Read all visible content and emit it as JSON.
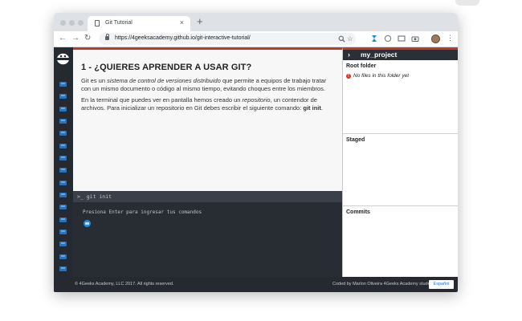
{
  "browser": {
    "tab_title": "Git Tutorial",
    "tab_close": "×",
    "new_tab": "+",
    "url": "https://4geeksacademy.github.io/git-interactive-tutorial/",
    "nav_back": "←",
    "nav_forward": "→",
    "nav_reload": "↻",
    "menu": "⋮"
  },
  "lesson": {
    "title": "1 - ¿QUIERES APRENDER A USAR GIT?",
    "p1_part1": "Git es un ",
    "p1_em": "sistema de control de versiones distribuido",
    "p1_part2": " que permite a equipos de trabajo tratar con un mismo documento o código al mismo tiempo, evitando choques entre los miembros.",
    "p2_part1": "En la terminal que puedes ver en pantalla hemos creado un ",
    "p2_em": "repositorio",
    "p2_part2": ", un contendor de archivos. Para inicializar un repositorio en Git debes escribir el siguiente comando: ",
    "p2_cmd": "git init",
    "p2_end": "."
  },
  "terminal": {
    "prompt": ">_ git init",
    "hint": "Presiona Enter para ingresar tus comandos"
  },
  "project": {
    "chevron": "›",
    "name": "my_project",
    "root_title": "Root folder",
    "root_msg": "No files in this folder yet",
    "err_mark": "!",
    "staged_title": "Staged",
    "commits_title": "Commits"
  },
  "footer": {
    "copyright": "© 4Geeks Academy, LLC 2017. All rights reserved.",
    "credit": "Coded by Marlon Oliveira 4Geeks Academy student",
    "language": "Español"
  },
  "colors": {
    "accent_red": "#c0392b",
    "sidebar_dark": "#252a31",
    "terminal_bg": "#282c33",
    "link_blue": "#1a73e8"
  },
  "icons": [
    "doc-icon",
    "lock-icon",
    "search-icon",
    "star-icon",
    "extension-icon",
    "circle-icon",
    "cast-icon",
    "camera-icon",
    "avatar",
    "logo-icon",
    "lesson-icon",
    "error-icon",
    "terminal-icon"
  ]
}
